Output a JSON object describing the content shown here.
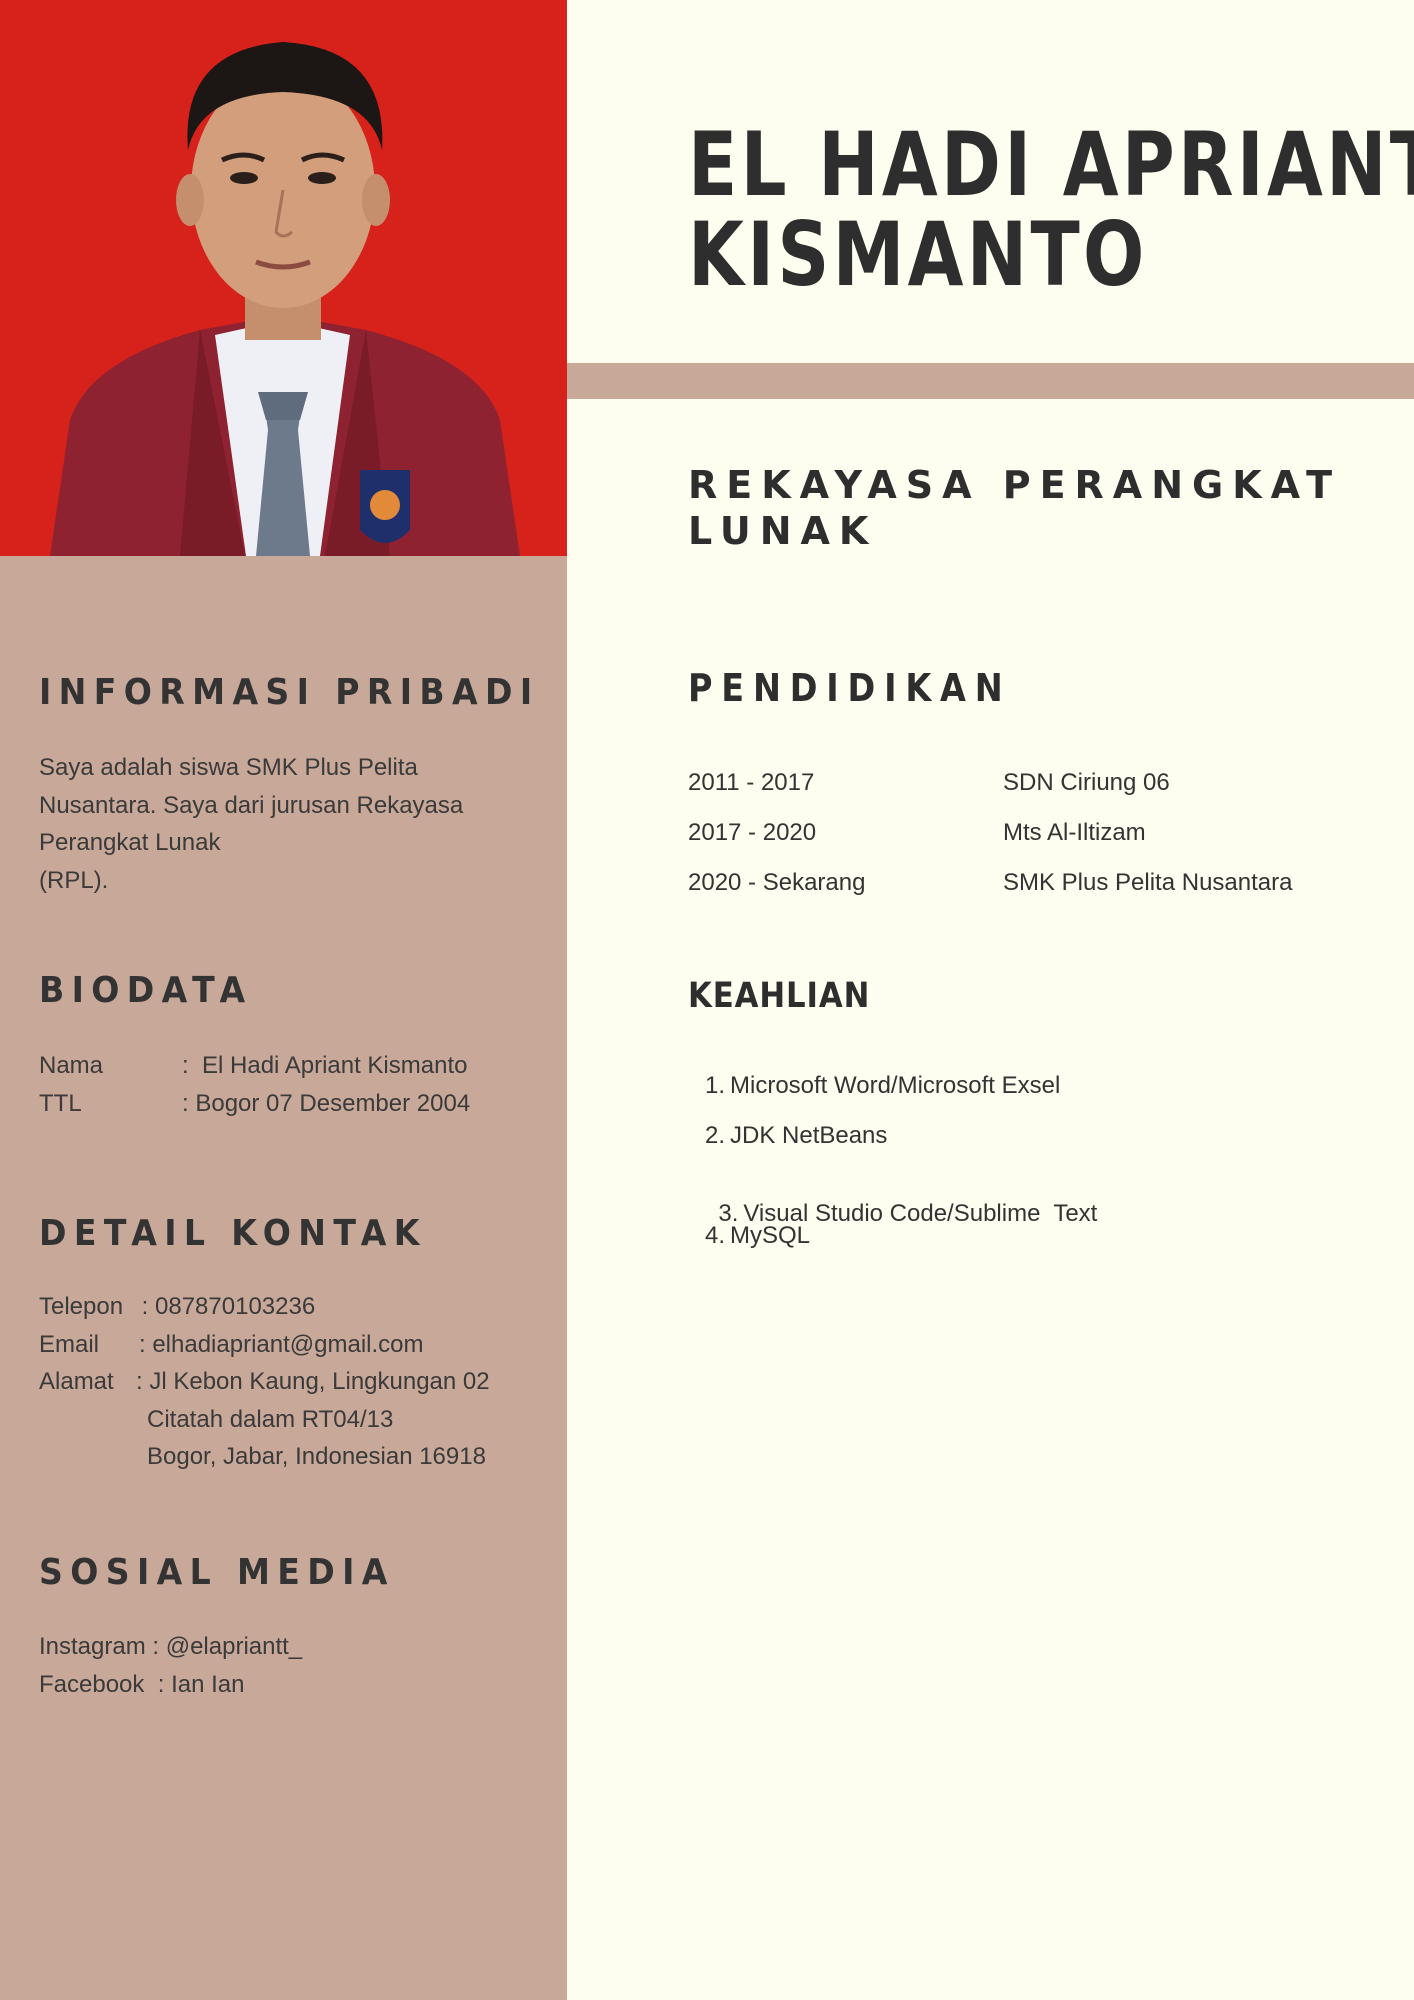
{
  "header": {
    "name_line1": "EL HADI APRIANT",
    "name_line2": "KISMANTO",
    "role_line1": "REKAYASA PERANGKAT",
    "role_line2": "LUNAK"
  },
  "sidebar": {
    "informasi": {
      "heading": "INFORMASI PRIBADI",
      "lines": [
        "Saya adalah siswa SMK Plus Pelita",
        "Nusantara. Saya dari jurusan Rekayasa",
        "Perangkat Lunak",
        "(RPL)."
      ]
    },
    "biodata": {
      "heading": "BIODATA",
      "rows": [
        {
          "label": "Nama",
          "value": ":  El Hadi Apriant Kismanto"
        },
        {
          "label": "TTL",
          "value": ": Bogor 07 Desember 2004"
        }
      ]
    },
    "kontak": {
      "heading": "DETAIL KONTAK",
      "rows": [
        {
          "label": "Telepon",
          "value": " : 087870103236"
        },
        {
          "label": "Email",
          "value": ": elhadiapriant@gmail.com"
        },
        {
          "label": "Alamat",
          "value": ": Jl Kebon Kaung, Lingkungan 02"
        }
      ],
      "address_cont": [
        "Citatah dalam  RT04/13",
        "Bogor, Jabar, Indonesian 16918"
      ]
    },
    "sosial": {
      "heading": "SOSIAL MEDIA",
      "lines": [
        "Instagram : @elapriantt_",
        "Facebook  : Ian Ian"
      ]
    }
  },
  "pendidikan": {
    "heading": "PENDIDIKAN",
    "rows": [
      {
        "years": "2011 - 2017",
        "school": "SDN Ciriung 06"
      },
      {
        "years": "2017 - 2020",
        "school": "Mts Al-Iltizam"
      },
      {
        "years": "2020 - Sekarang",
        "school": "SMK Plus Pelita Nusantara"
      }
    ]
  },
  "keahlian": {
    "heading": "KEAHLIAN",
    "items": [
      {
        "num": "1.",
        "text": "Microsoft Word/Microsoft Exsel"
      },
      {
        "num": "2.",
        "text": "JDK NetBeans"
      },
      {
        "num": "3.",
        "text": "Visual Studio Code/Sublime  Text"
      },
      {
        "num": "4.",
        "text": "MySQL"
      }
    ]
  },
  "colors": {
    "sidebar": "#c8a898",
    "photo_background": "#d6221b",
    "page_background": "#fdfdf0",
    "text": "#333333"
  }
}
